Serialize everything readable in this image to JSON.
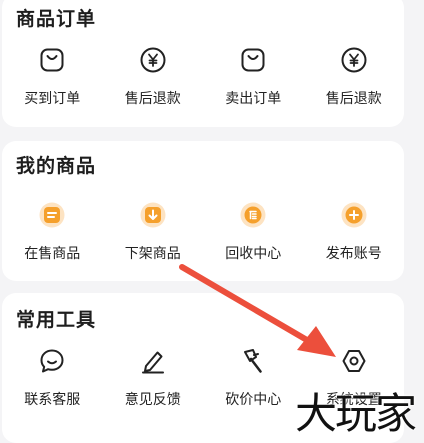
{
  "sections": [
    {
      "title": "商品订单",
      "items": [
        {
          "label": "买到订单",
          "icon": "shopping-bag-icon"
        },
        {
          "label": "售后退款",
          "icon": "yen-refund-icon"
        },
        {
          "label": "卖出订单",
          "icon": "shopping-bag-icon"
        },
        {
          "label": "售后退款",
          "icon": "yen-refund-icon"
        }
      ]
    },
    {
      "title": "我的商品",
      "items": [
        {
          "label": "在售商品",
          "icon": "on-sale-icon"
        },
        {
          "label": "下架商品",
          "icon": "delist-icon"
        },
        {
          "label": "回收中心",
          "icon": "recycle-icon"
        },
        {
          "label": "发布账号",
          "icon": "publish-plus-icon"
        }
      ]
    },
    {
      "title": "常用工具",
      "items": [
        {
          "label": "联系客服",
          "icon": "chat-bubble-icon"
        },
        {
          "label": "意见反馈",
          "icon": "pencil-icon"
        },
        {
          "label": "砍价中心",
          "icon": "axe-icon"
        },
        {
          "label": "系统设置",
          "icon": "settings-hex-icon"
        }
      ]
    }
  ],
  "watermark": "大玩家",
  "colors": {
    "accent": "#f5a02c",
    "arrow": "#ec4f3c",
    "card": "#ffffff",
    "background": "#f4f4f6"
  }
}
